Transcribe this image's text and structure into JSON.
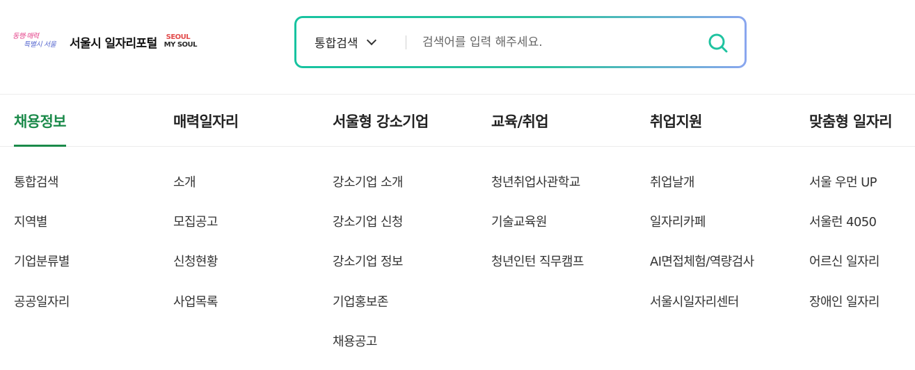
{
  "logo": {
    "script_line1": "동행·매력",
    "script_line2": "특별시 서울",
    "title": "서울시 일자리포털",
    "brand_line1": "SEOUL",
    "brand_line2": "MY SOUL"
  },
  "search": {
    "scope": "통합검색",
    "placeholder": "검색어를 입력 해주세요.",
    "accent_color": "#1fc3a0"
  },
  "nav": [
    {
      "label": "채용정보",
      "active": true,
      "items": [
        "통합검색",
        "지역별",
        "기업분류별",
        "공공일자리"
      ]
    },
    {
      "label": "매력일자리",
      "active": false,
      "items": [
        "소개",
        "모집공고",
        "신청현황",
        "사업목록"
      ]
    },
    {
      "label": "서울형 강소기업",
      "active": false,
      "items": [
        "강소기업 소개",
        "강소기업 신청",
        "강소기업 정보",
        "기업홍보존",
        "채용공고"
      ]
    },
    {
      "label": "교육/취업",
      "active": false,
      "items": [
        "청년취업사관학교",
        "기술교육원",
        "청년인턴 직무캠프"
      ]
    },
    {
      "label": "취업지원",
      "active": false,
      "items": [
        "취업날개",
        "일자리카페",
        "AI면접체험/역량검사",
        "서울시일자리센터"
      ]
    },
    {
      "label": "맞춤형 일자리",
      "active": false,
      "items": [
        "서울 우먼 UP",
        "서울런 4050",
        "어르신 일자리",
        "장애인 일자리"
      ]
    }
  ],
  "colors": {
    "active_nav": "#1b8a4a",
    "text": "#222222"
  }
}
